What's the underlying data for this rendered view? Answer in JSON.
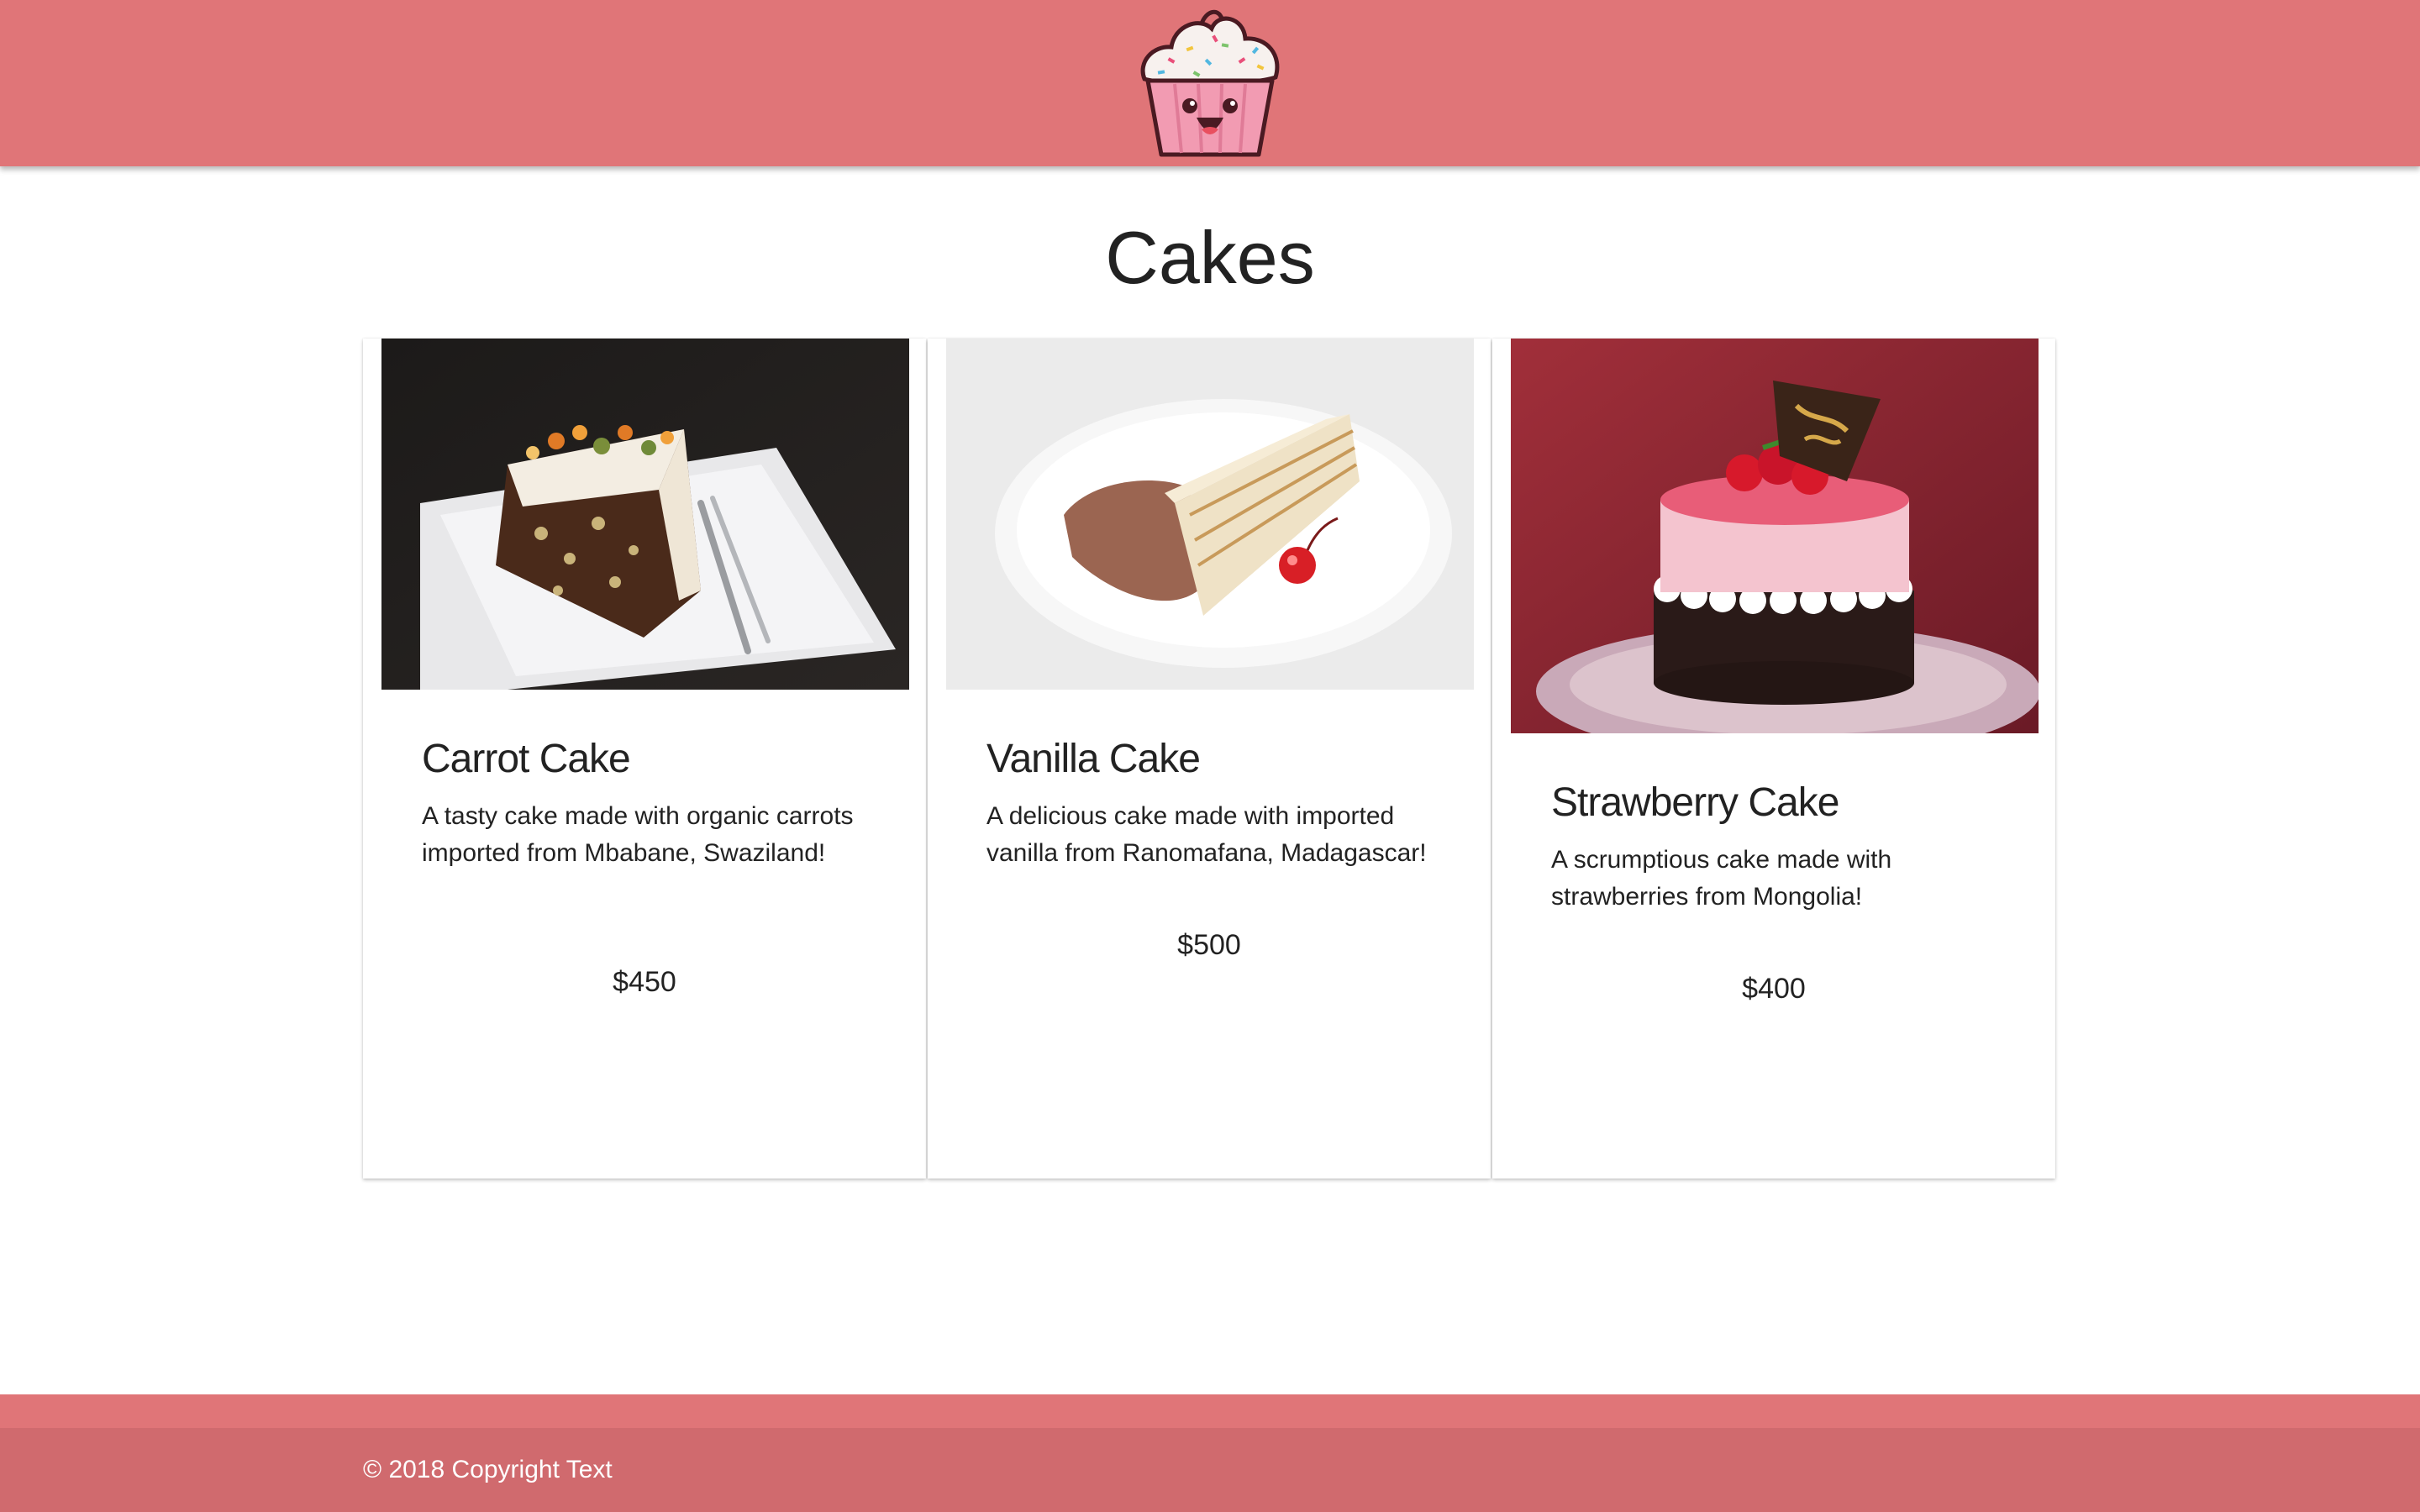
{
  "header": {
    "logo_icon": "cupcake-logo-icon",
    "brand_color": "#e07578"
  },
  "page": {
    "title": "Cakes"
  },
  "cards": [
    {
      "title": "Carrot Cake",
      "description": "A tasty cake made with organic carrots imported from Mbabane, Swaziland!",
      "price": "$450",
      "image_icon": "carrot-cake-photo"
    },
    {
      "title": "Vanilla Cake",
      "description": "A delicious cake made with imported vanilla from Ranomafana, Madagascar!",
      "price": "$500",
      "image_icon": "vanilla-cake-photo"
    },
    {
      "title": "Strawberry Cake",
      "description": "A scrumptious cake made with strawberries from Mongolia!",
      "price": "$400",
      "image_icon": "strawberry-cake-photo"
    }
  ],
  "footer": {
    "copyright": "© 2018 Copyright Text",
    "footer_color": "#d06a6e"
  }
}
